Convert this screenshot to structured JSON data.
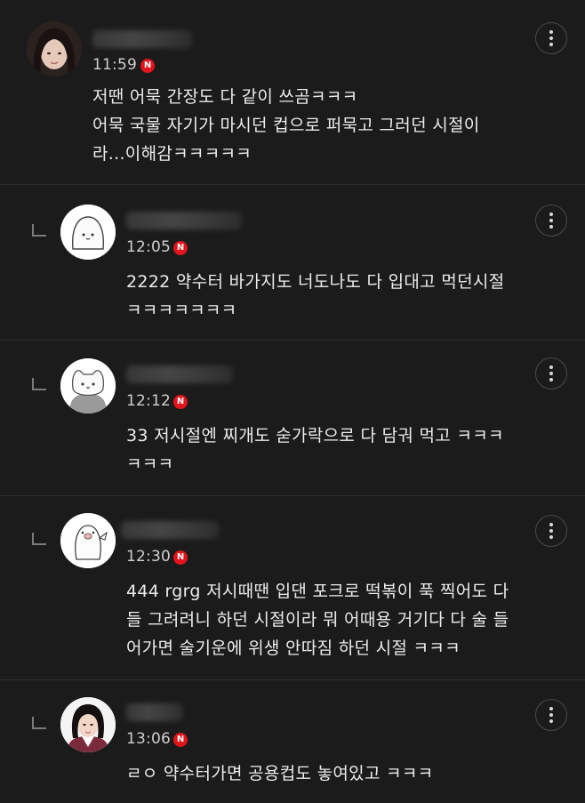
{
  "comments": [
    {
      "time": "11:59",
      "badge": "N",
      "text": "저땐 어묵 간장도 다 같이 쓰곰ㅋㅋㅋ\n어묵 국물 자기가 마시던 컵으로 퍼묵고 그러던 시절이\n라...이해감ㅋㅋㅋㅋㅋ",
      "more_icon": "more-vertical-icon"
    },
    {
      "time": "12:05",
      "badge": "N",
      "text": "2222 약수터 바가지도 너도나도 다 입대고 먹던시절\nㅋㅋㅋㅋㅋㅋㅋ",
      "more_icon": "more-vertical-icon"
    },
    {
      "time": "12:12",
      "badge": "N",
      "text": "33 저시절엔 찌개도 숟가락으로 다 담궈 먹고 ㅋㅋㅋ\nㅋㅋㅋ",
      "more_icon": "more-vertical-icon"
    },
    {
      "time": "12:30",
      "badge": "N",
      "text": "444 rgrg 저시때땐 입댄 포크로 떡볶이 푹 찍어도 다\n들 그려려니 하던 시절이라 뭐 어때용 거기다 다 술 들\n어가면 술기운에 위생 안따짐 하던 시절 ㅋㅋㅋ",
      "more_icon": "more-vertical-icon"
    },
    {
      "time": "13:06",
      "badge": "N",
      "text": "ㄹㅇ 약수터가면 공용컵도 놓여있고 ㅋㅋㅋ",
      "more_icon": "more-vertical-icon"
    }
  ]
}
